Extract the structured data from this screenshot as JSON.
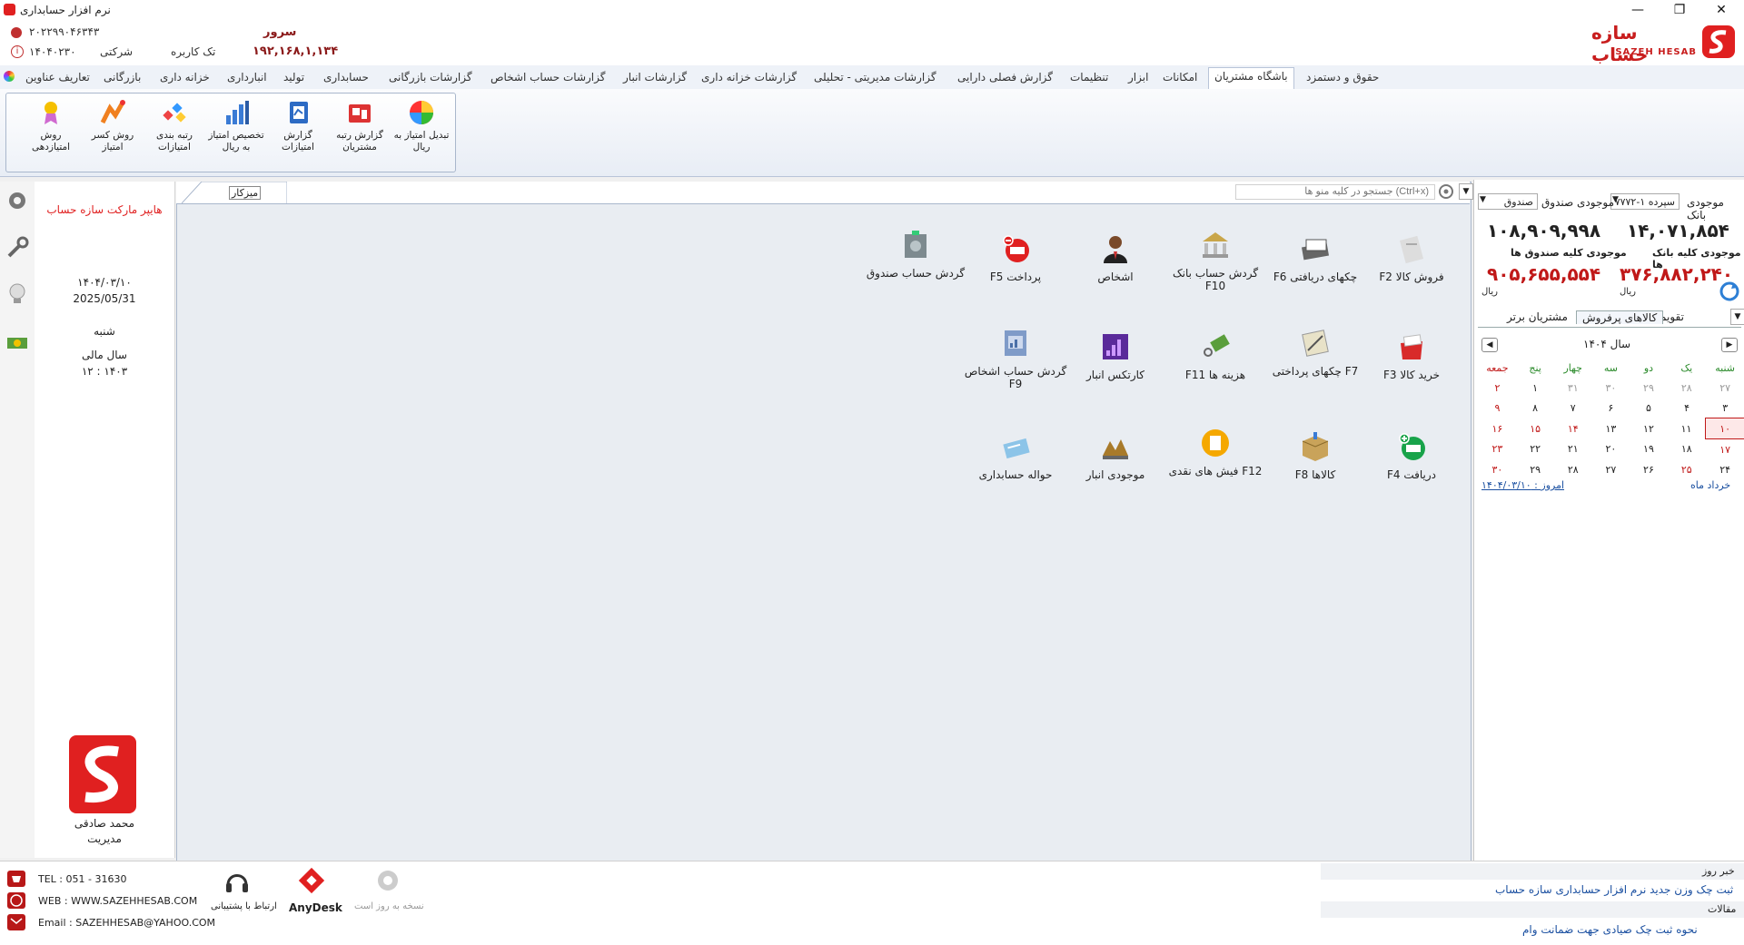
{
  "window": {
    "title": "نرم افزار حسابداری"
  },
  "header": {
    "phone": "۲۰۲۲۹۹۰۴۶۳۴۳",
    "code": "۱۴۰۴۰۲۳۰",
    "company_label": "شرکتی",
    "user_mode": "تک کاربره",
    "server_label": "سرور",
    "server_ip": "۱۹۲,۱۶۸,۱,۱۳۴",
    "brand_fa": "سازه حساب",
    "brand_en": "SAZEH HESAB"
  },
  "menu": {
    "items": [
      "حقوق و دستمزد",
      "باشگاه مشتریان",
      "امکانات",
      "ابزار",
      "تنظیمات",
      "گزارش فصلی دارایی",
      "گزارشات مدیریتی - تحلیلی",
      "گزارشات خزانه داری",
      "گزارشات انبار",
      "گزارشات حساب اشخاص",
      "گزارشات بازرگانی",
      "حسابداری",
      "تولید",
      "انبارداری",
      "خزانه داری",
      "بازرگانی",
      "تعاریف عناوین"
    ],
    "active_index": 1
  },
  "ribbon": {
    "buttons": [
      {
        "label": "تبدیل امتیاز به ریال",
        "icon": "color-wheel-icon"
      },
      {
        "label": "گزارش رتبه مشتریان",
        "icon": "ranking-report-icon"
      },
      {
        "label": "گزارش امتیازات",
        "icon": "points-report-icon"
      },
      {
        "label": "تخصیص امتیاز به ریال",
        "icon": "bar-chart-icon"
      },
      {
        "label": "رتبه بندی امتیازات",
        "icon": "ranking-icon"
      },
      {
        "label": "روش کسر امتیاز",
        "icon": "deduct-points-icon"
      },
      {
        "label": "روش امتیازدهی",
        "icon": "award-icon"
      }
    ]
  },
  "left_panel": {
    "store_name": "هایپر مارکت سازه حساب",
    "date_fa": "۱۴۰۴/۰۳/۱۰",
    "date_en": "2025/05/31",
    "weekday": "شنبه",
    "fiscal_label": "سال مالی",
    "fiscal_value": "۱۲ : ۱۴۰۳",
    "user_name": "محمد صادقی",
    "user_role": "مدیریت"
  },
  "desktop": {
    "tab_label": "میزکار",
    "search_placeholder": "جستجو در کلیه منو ها (Ctrl+x)",
    "tiles": [
      {
        "label": "F2  فروش کالا",
        "icon": "sales-invoice-icon"
      },
      {
        "label": "F6  چکهای دریافتی",
        "icon": "received-cheques-icon"
      },
      {
        "label": "گردش حساب بانک F10",
        "icon": "bank-icon"
      },
      {
        "label": "اشخاص",
        "icon": "person-icon"
      },
      {
        "label": "F5  پرداخت",
        "icon": "payment-icon"
      },
      {
        "label": "گردش حساب صندوق",
        "icon": "cashbox-icon"
      },
      {
        "label": "F3  خرید کالا",
        "icon": "purchase-icon"
      },
      {
        "label": "چکهای پرداختی F7",
        "icon": "paid-cheques-icon"
      },
      {
        "label": "F11  هزینه ها",
        "icon": "expenses-icon"
      },
      {
        "label": "کارتکس انبار",
        "icon": "warehouse-cardex-icon"
      },
      {
        "label": "گردش حساب اشخاص  F9",
        "icon": "persons-ledger-icon"
      },
      {
        "label": "F4  دریافت",
        "icon": "receipt-icon"
      },
      {
        "label": "F8  کالاها",
        "icon": "goods-icon"
      },
      {
        "label": "فیش های نقدی F12",
        "icon": "cash-slip-icon"
      },
      {
        "label": "موجودی انبار",
        "icon": "inventory-icon"
      },
      {
        "label": "حواله حسابداری",
        "icon": "accounting-voucher-icon"
      }
    ]
  },
  "right_panel": {
    "bank_balance_label": "موجودی بانک",
    "bank_select": "سپرده ۱-۷۷۷۲",
    "cash_balance_label": "موجودی صندوق",
    "cash_select": "صندوق",
    "bank_balance": "۱۴,۰۷۱,۸۵۴",
    "cash_balance": "۱۰۸,۹۰۹,۹۹۸",
    "all_banks_label": "موجودی کلیه بانک ها",
    "all_cash_label": "موجودی کلیه صندوق ها",
    "all_banks_value": "۳۷۶,۸۸۲,۲۴۰",
    "all_cash_value": "۹۰۵,۶۵۵,۵۵۴",
    "currency": "ریال",
    "tabs": [
      "تقویم",
      "کالاهای پرفروش",
      "مشتریان برتر"
    ],
    "calendar": {
      "year_label": "سال ۱۴۰۴",
      "weekdays": [
        "شنبه",
        "یک",
        "دو",
        "سه",
        "چهار",
        "پنج",
        "جمعه"
      ],
      "weeks": [
        [
          "۲۷",
          "۲۸",
          "۲۹",
          "۳۰",
          "۳۱",
          "۱",
          "۲"
        ],
        [
          "۳",
          "۴",
          "۵",
          "۶",
          "۷",
          "۸",
          "۹"
        ],
        [
          "۱۰",
          "۱۱",
          "۱۲",
          "۱۳",
          "۱۴",
          "۱۵",
          "۱۶"
        ],
        [
          "۱۷",
          "۱۸",
          "۱۹",
          "۲۰",
          "۲۱",
          "۲۲",
          "۲۳"
        ],
        [
          "۲۴",
          "۲۵",
          "۲۶",
          "۲۷",
          "۲۸",
          "۲۹",
          "۳۰"
        ]
      ],
      "month_label": "خرداد ماه",
      "today_label": "امروز : ۱۴۰۴/۰۳/۱۰"
    }
  },
  "footer": {
    "tel": "TEL : 051 - 31630",
    "web": "WEB : WWW.SAZEHHESAB.COM",
    "email": "Email : SAZEHHESAB@YAHOO.COM",
    "support_label": "ارتباط با پشتیبانی",
    "anydesk_label": "AnyDesk",
    "update_label": "نسخه به روز است",
    "news_title": "خبر روز",
    "news_text": "ثبت چک وزن جدید نرم افزار حسابداری سازه حساب",
    "articles_title": "مقالات",
    "articles_text": "نحوه ثبت چک صیادی جهت ضمانت وام"
  },
  "colors": {
    "accent_red": "#e02020",
    "link_blue": "#1a4fa0",
    "menu_bg": "#eef2f8"
  }
}
